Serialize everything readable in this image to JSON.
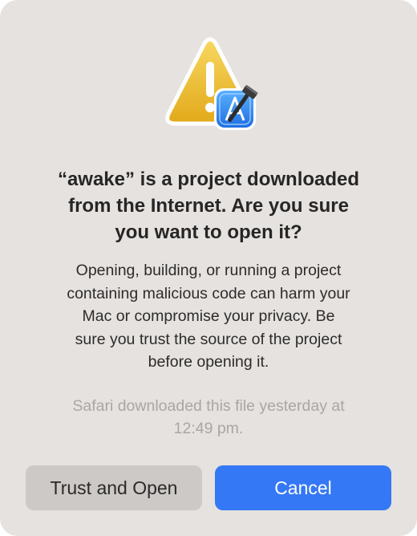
{
  "dialog": {
    "title_lines": [
      "“awake” is a project downloaded",
      "from the Internet. Are you sure",
      "you want to open it?"
    ],
    "message_lines": [
      "Opening, building, or running a project",
      "containing malicious code can harm your",
      "Mac or compromise your privacy. Be",
      "sure you trust the source of the project",
      "before opening it."
    ],
    "download_info_lines": [
      "Safari downloaded this file yesterday at",
      "12:49 pm."
    ],
    "buttons": {
      "trust_label": "Trust and Open",
      "cancel_label": "Cancel"
    },
    "icons": {
      "warning": "warning-triangle-icon",
      "app_badge": "xcode-icon"
    }
  },
  "colors": {
    "background": "#e6e2df",
    "primary_button": "#3478f6",
    "secondary_button": "#cdc9c6",
    "muted_text": "#a9a6a3",
    "warning_yellow": "#f2c12e"
  }
}
